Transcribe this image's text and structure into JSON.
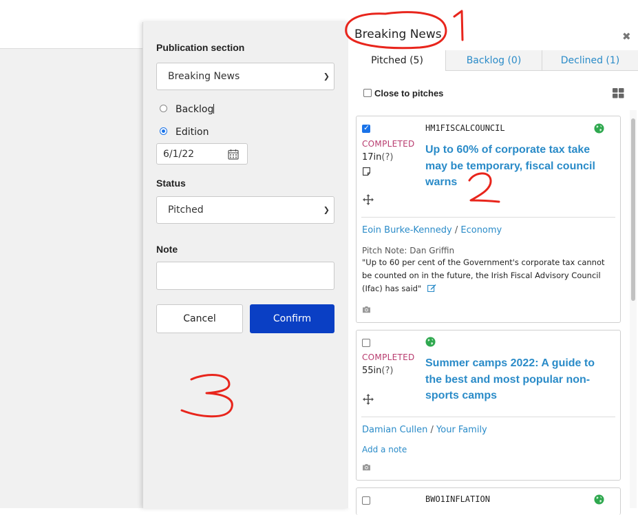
{
  "form": {
    "publication_label": "Publication section",
    "publication_value": "Breaking News",
    "radio_backlog": "Backlog",
    "radio_edition": "Edition",
    "date_value": "6/1/22",
    "status_label": "Status",
    "status_value": "Pitched",
    "note_label": "Note",
    "note_value": "",
    "cancel_label": "Cancel",
    "confirm_label": "Confirm"
  },
  "panel": {
    "title": "Breaking News",
    "close": "✖",
    "tabs": [
      {
        "label": "Pitched (5)",
        "active": true
      },
      {
        "label": "Backlog (0)",
        "active": false
      },
      {
        "label": "Declined (1)",
        "active": false
      }
    ],
    "close_to_pitches": "Close to pitches"
  },
  "cards": [
    {
      "checked": true,
      "slug": "HM1FISCALCOUNCIL",
      "status": "COMPLETED",
      "length": "17in",
      "length_q": "(?)",
      "headline": "Up to 60% of corporate tax take may be temporary, fiscal council warns",
      "author": "Eoin Burke-Kennedy",
      "section": "Economy",
      "pitch_note_label": "Pitch Note: Dan Griffin",
      "pitch_note": "\"Up to 60 per cent of the Government's corporate tax cannot be counted on in the future, the Irish Fiscal Advisory Council (Ifac) has said\""
    },
    {
      "checked": false,
      "slug": "",
      "status": "COMPLETED",
      "length": "55in",
      "length_q": "(?)",
      "headline": "Summer camps 2022: A guide to the best and most popular non-sports camps",
      "author": "Damian Cullen",
      "section": "Your Family",
      "add_note": "Add a note"
    },
    {
      "checked": false,
      "slug": "BWO1INFLATION"
    }
  ],
  "colors": {
    "accent_blue": "#2a8bc8",
    "confirm_blue": "#0a3fc4",
    "status_red": "#b83b6e",
    "annotation_red": "#e8251c"
  }
}
